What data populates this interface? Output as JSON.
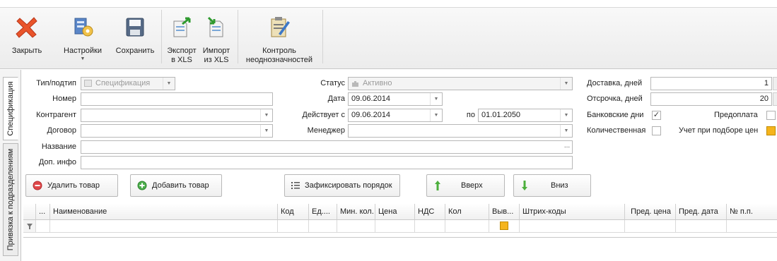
{
  "toolbar": {
    "close_label": "Закрыть",
    "settings_label": "Настройки",
    "save_label": "Сохранить",
    "export_label_1": "Экспорт",
    "export_label_2": "в XLS",
    "import_label_1": "Импорт",
    "import_label_2": "из XLS",
    "ambiguity_label_1": "Контроль",
    "ambiguity_label_2": "неоднозначностей"
  },
  "tabs": {
    "spec": "Спецификация",
    "binding": "Привязка к подразделениям"
  },
  "form": {
    "type_label": "Тип/подтип",
    "type_value": "Спецификация",
    "number_label": "Номер",
    "number_value": "",
    "counterparty_label": "Контрагент",
    "counterparty_value": "",
    "contract_label": "Договор",
    "contract_value": "",
    "name_label": "Название",
    "name_value": "",
    "extra_label": "Доп. инфо",
    "extra_value": "",
    "status_label": "Статус",
    "status_value": "Активно",
    "date_label": "Дата",
    "date_value": "09.06.2014",
    "valid_from_label": "Действует с",
    "valid_from_value": "09.06.2014",
    "valid_to_label": "по",
    "valid_to_value": "01.01.2050",
    "manager_label": "Менеджер",
    "manager_value": "",
    "delivery_label": "Доставка, дней",
    "delivery_value": "1",
    "deferral_label": "Отсрочка, дней",
    "deferral_value": "20",
    "bank_days_label": "Банковские дни",
    "bank_days_checked": true,
    "prepay_label": "Предоплата",
    "prepay_checked": false,
    "quantitative_label": "Количественная",
    "quantitative_checked": false,
    "price_pick_label": "Учет при подборе цен"
  },
  "actions": {
    "delete": "Удалить товар",
    "add": "Добавить товар",
    "fix_order": "Зафиксировать порядок",
    "up": "Вверх",
    "down": "Вниз"
  },
  "grid": {
    "columns": [
      "...",
      "Наименование",
      "Код",
      "Ед....",
      "Мин. кол.",
      "Цена",
      "НДС",
      "Кол",
      "Выв...",
      "Штрих-коды",
      "Пред. цена",
      "Пред. дата",
      "№ п.п."
    ]
  },
  "colors": {
    "delete_icon": "#e0484a",
    "add_icon": "#4cae4c",
    "up_arrow": "#4caf3c",
    "checkbox_orange": "#f5b41c"
  }
}
